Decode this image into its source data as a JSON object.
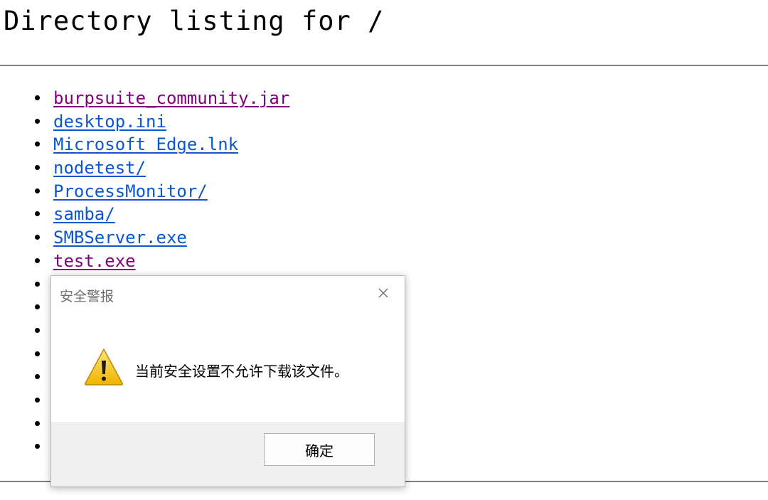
{
  "page": {
    "title": "Directory listing for /"
  },
  "listing": {
    "items": [
      {
        "label": "burpsuite_community.jar",
        "state": "visited"
      },
      {
        "label": "desktop.ini",
        "state": "link"
      },
      {
        "label": "Microsoft Edge.lnk",
        "state": "link"
      },
      {
        "label": "nodetest/",
        "state": "link"
      },
      {
        "label": "ProcessMonitor/",
        "state": "link"
      },
      {
        "label": "samba/",
        "state": "link"
      },
      {
        "label": "SMBServer.exe",
        "state": "link"
      },
      {
        "label": "test.exe",
        "state": "visited"
      },
      {
        "label": "",
        "state": "hidden"
      },
      {
        "label": "",
        "state": "hidden"
      },
      {
        "label": "",
        "state": "hidden"
      },
      {
        "label": "",
        "state": "hidden"
      },
      {
        "label": "",
        "state": "hidden"
      },
      {
        "label": "",
        "state": "hidden"
      },
      {
        "label": "",
        "state": "hidden"
      },
      {
        "label": "",
        "state": "hidden"
      }
    ]
  },
  "dialog": {
    "title": "安全警报",
    "message": "当前安全设置不允许下载该文件。",
    "ok_label": "确定",
    "icons": {
      "close": "close-icon",
      "warning": "warning-icon"
    }
  },
  "colors": {
    "link": "#0b57d0",
    "visited": "#800080",
    "footer": "#f0f0f0"
  }
}
